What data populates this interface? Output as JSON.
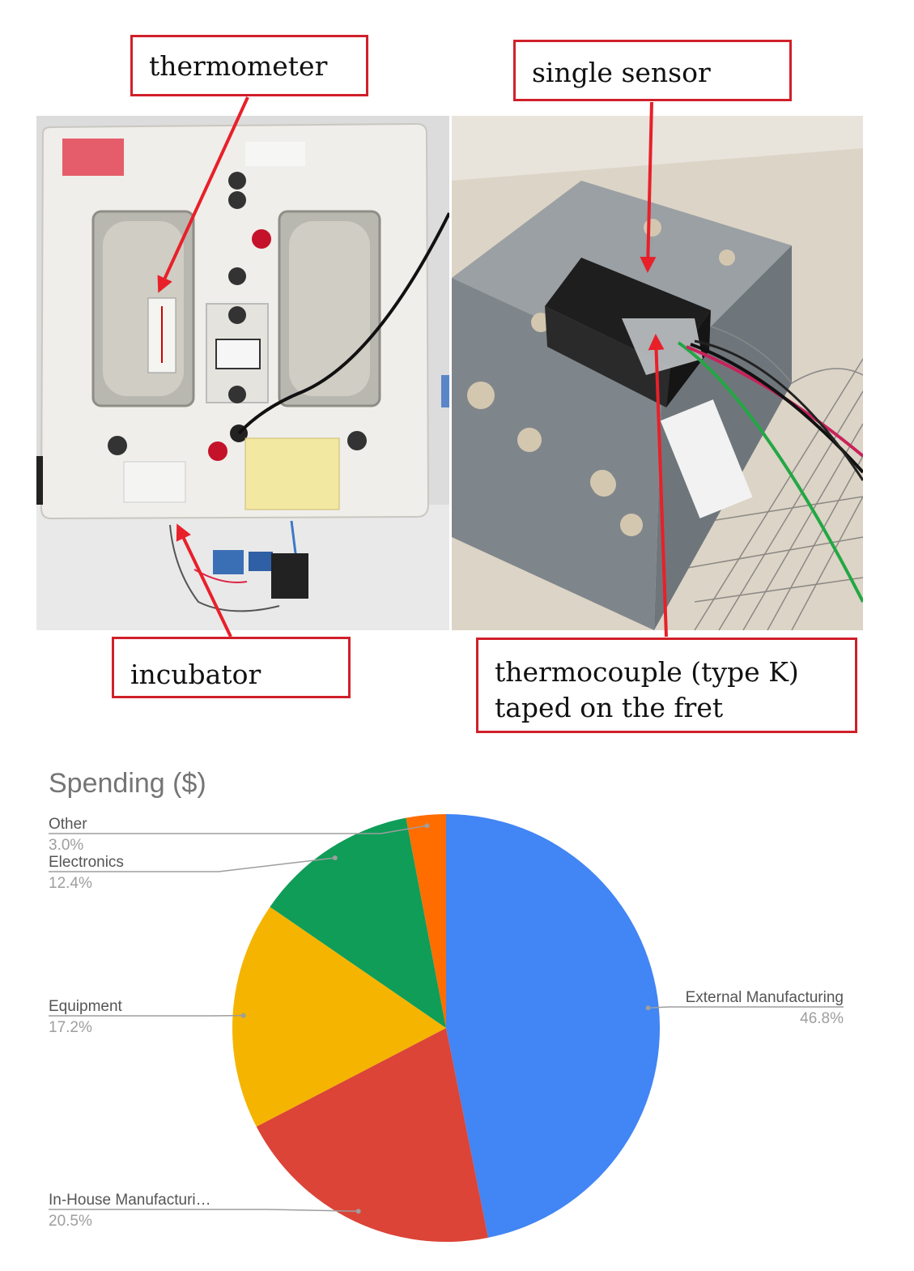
{
  "annotations": {
    "thermometer": "thermometer",
    "single_sensor": "single sensor",
    "incubator": "incubator",
    "thermocouple_line1": "thermocouple (type K)",
    "thermocouple_line2": "taped on the fret"
  },
  "colors": {
    "callout_border": "#d0202a",
    "arrow": "#e8202a"
  },
  "chart_data": {
    "type": "pie",
    "title": "Spending ($)",
    "categories": [
      "External Manufacturing",
      "In-House Manufacturi…",
      "Equipment",
      "Electronics",
      "Other"
    ],
    "values": [
      46.8,
      20.5,
      17.2,
      12.4,
      3.0
    ],
    "labels": [
      "46.8%",
      "20.5%",
      "17.2%",
      "12.4%",
      "3.0%"
    ],
    "colors": [
      "#4285f4",
      "#db4437",
      "#f4b400",
      "#0f9d58",
      "#ff6d00"
    ],
    "start_angle_deg": 0,
    "direction": "clockwise",
    "legend": "labeled slices"
  }
}
